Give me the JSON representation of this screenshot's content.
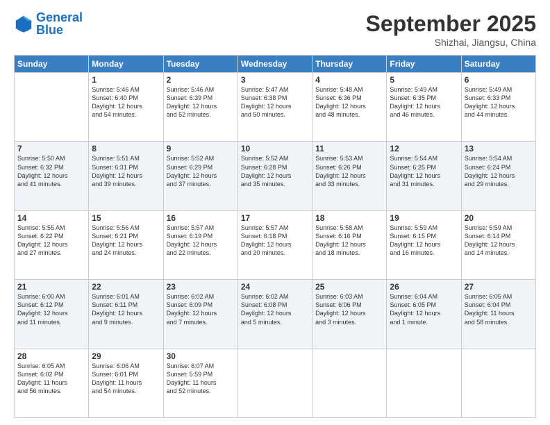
{
  "header": {
    "logo_general": "General",
    "logo_blue": "Blue",
    "month": "September 2025",
    "location": "Shizhai, Jiangsu, China"
  },
  "weekdays": [
    "Sunday",
    "Monday",
    "Tuesday",
    "Wednesday",
    "Thursday",
    "Friday",
    "Saturday"
  ],
  "weeks": [
    [
      {
        "day": "",
        "info": ""
      },
      {
        "day": "1",
        "info": "Sunrise: 5:46 AM\nSunset: 6:40 PM\nDaylight: 12 hours\nand 54 minutes."
      },
      {
        "day": "2",
        "info": "Sunrise: 5:46 AM\nSunset: 6:39 PM\nDaylight: 12 hours\nand 52 minutes."
      },
      {
        "day": "3",
        "info": "Sunrise: 5:47 AM\nSunset: 6:38 PM\nDaylight: 12 hours\nand 50 minutes."
      },
      {
        "day": "4",
        "info": "Sunrise: 5:48 AM\nSunset: 6:36 PM\nDaylight: 12 hours\nand 48 minutes."
      },
      {
        "day": "5",
        "info": "Sunrise: 5:49 AM\nSunset: 6:35 PM\nDaylight: 12 hours\nand 46 minutes."
      },
      {
        "day": "6",
        "info": "Sunrise: 5:49 AM\nSunset: 6:33 PM\nDaylight: 12 hours\nand 44 minutes."
      }
    ],
    [
      {
        "day": "7",
        "info": "Sunrise: 5:50 AM\nSunset: 6:32 PM\nDaylight: 12 hours\nand 41 minutes."
      },
      {
        "day": "8",
        "info": "Sunrise: 5:51 AM\nSunset: 6:31 PM\nDaylight: 12 hours\nand 39 minutes."
      },
      {
        "day": "9",
        "info": "Sunrise: 5:52 AM\nSunset: 6:29 PM\nDaylight: 12 hours\nand 37 minutes."
      },
      {
        "day": "10",
        "info": "Sunrise: 5:52 AM\nSunset: 6:28 PM\nDaylight: 12 hours\nand 35 minutes."
      },
      {
        "day": "11",
        "info": "Sunrise: 5:53 AM\nSunset: 6:26 PM\nDaylight: 12 hours\nand 33 minutes."
      },
      {
        "day": "12",
        "info": "Sunrise: 5:54 AM\nSunset: 6:25 PM\nDaylight: 12 hours\nand 31 minutes."
      },
      {
        "day": "13",
        "info": "Sunrise: 5:54 AM\nSunset: 6:24 PM\nDaylight: 12 hours\nand 29 minutes."
      }
    ],
    [
      {
        "day": "14",
        "info": "Sunrise: 5:55 AM\nSunset: 6:22 PM\nDaylight: 12 hours\nand 27 minutes."
      },
      {
        "day": "15",
        "info": "Sunrise: 5:56 AM\nSunset: 6:21 PM\nDaylight: 12 hours\nand 24 minutes."
      },
      {
        "day": "16",
        "info": "Sunrise: 5:57 AM\nSunset: 6:19 PM\nDaylight: 12 hours\nand 22 minutes."
      },
      {
        "day": "17",
        "info": "Sunrise: 5:57 AM\nSunset: 6:18 PM\nDaylight: 12 hours\nand 20 minutes."
      },
      {
        "day": "18",
        "info": "Sunrise: 5:58 AM\nSunset: 6:16 PM\nDaylight: 12 hours\nand 18 minutes."
      },
      {
        "day": "19",
        "info": "Sunrise: 5:59 AM\nSunset: 6:15 PM\nDaylight: 12 hours\nand 16 minutes."
      },
      {
        "day": "20",
        "info": "Sunrise: 5:59 AM\nSunset: 6:14 PM\nDaylight: 12 hours\nand 14 minutes."
      }
    ],
    [
      {
        "day": "21",
        "info": "Sunrise: 6:00 AM\nSunset: 6:12 PM\nDaylight: 12 hours\nand 11 minutes."
      },
      {
        "day": "22",
        "info": "Sunrise: 6:01 AM\nSunset: 6:11 PM\nDaylight: 12 hours\nand 9 minutes."
      },
      {
        "day": "23",
        "info": "Sunrise: 6:02 AM\nSunset: 6:09 PM\nDaylight: 12 hours\nand 7 minutes."
      },
      {
        "day": "24",
        "info": "Sunrise: 6:02 AM\nSunset: 6:08 PM\nDaylight: 12 hours\nand 5 minutes."
      },
      {
        "day": "25",
        "info": "Sunrise: 6:03 AM\nSunset: 6:06 PM\nDaylight: 12 hours\nand 3 minutes."
      },
      {
        "day": "26",
        "info": "Sunrise: 6:04 AM\nSunset: 6:05 PM\nDaylight: 12 hours\nand 1 minute."
      },
      {
        "day": "27",
        "info": "Sunrise: 6:05 AM\nSunset: 6:04 PM\nDaylight: 11 hours\nand 58 minutes."
      }
    ],
    [
      {
        "day": "28",
        "info": "Sunrise: 6:05 AM\nSunset: 6:02 PM\nDaylight: 11 hours\nand 56 minutes."
      },
      {
        "day": "29",
        "info": "Sunrise: 6:06 AM\nSunset: 6:01 PM\nDaylight: 11 hours\nand 54 minutes."
      },
      {
        "day": "30",
        "info": "Sunrise: 6:07 AM\nSunset: 5:59 PM\nDaylight: 11 hours\nand 52 minutes."
      },
      {
        "day": "",
        "info": ""
      },
      {
        "day": "",
        "info": ""
      },
      {
        "day": "",
        "info": ""
      },
      {
        "day": "",
        "info": ""
      }
    ]
  ]
}
